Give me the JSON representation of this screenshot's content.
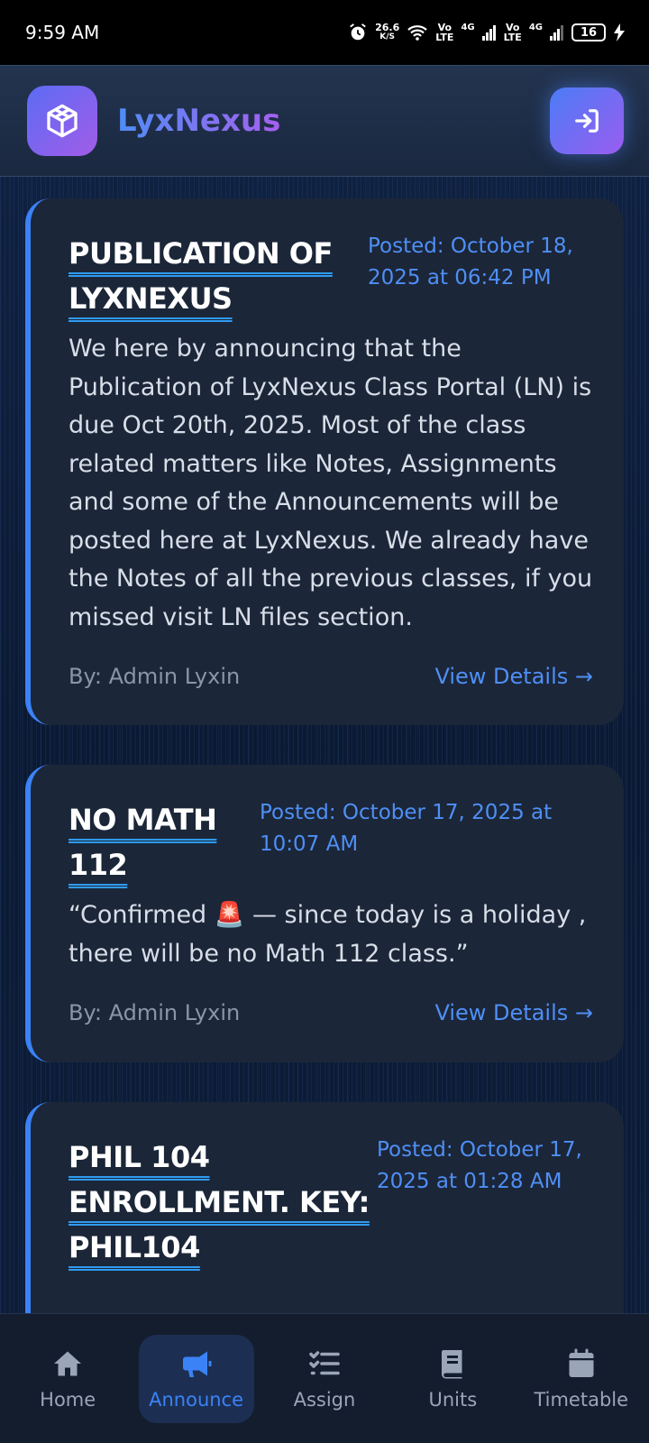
{
  "status_bar": {
    "time": "9:59 AM",
    "net_speed_value": "26.6",
    "net_speed_unit": "K/S",
    "sim1_top": "Vo",
    "sim1_bottom": "LTE",
    "sim1_net": "4G",
    "sim2_top": "Vo",
    "sim2_bottom": "LTE",
    "sim2_net": "4G",
    "battery": "16"
  },
  "header": {
    "app_name": "LyxNexus",
    "logo_icon": "cube-icon",
    "login_icon": "sign-in-icon"
  },
  "announcements": [
    {
      "title_line1": "PUBLICATION OF",
      "title_line2": "LYXNEXUS",
      "posted": "Posted: October 18, 2025 at 06:42 PM",
      "body": "We here by announcing that the Publication of LyxNexus Class Portal (LN) is due Oct 20th, 2025. Most of the class related matters like Notes, Assignments and some of the Announcements will be posted here at LyxNexus. We already have the Notes of all the previous classes, if you missed visit LN files section.",
      "author": "By: Admin Lyxin",
      "details": "View Details →"
    },
    {
      "title_line1": "NO MATH",
      "title_line2": "112",
      "posted": "Posted: October 17, 2025 at 10:07 AM",
      "body": "“Confirmed 🚨 — since today is a holiday , there will be no Math 112 class.”",
      "author": "By: Admin Lyxin",
      "details": "View Details →"
    },
    {
      "title_line1": "PHIL 104",
      "title_line2": "ENROLLMENT. KEY:",
      "title_line3": "PHIL104",
      "posted": "Posted: October 17, 2025 at 01:28 AM"
    }
  ],
  "bottom_nav": [
    {
      "label": "Home",
      "icon": "home-icon"
    },
    {
      "label": "Announce",
      "icon": "megaphone-icon",
      "active": true
    },
    {
      "label": "Assign",
      "icon": "task-list-icon"
    },
    {
      "label": "Units",
      "icon": "book-icon"
    },
    {
      "label": "Timetable",
      "icon": "calendar-icon"
    }
  ],
  "colors": {
    "accent": "#3b82f6",
    "card": "#1c2638",
    "background": "#0b1a33"
  }
}
